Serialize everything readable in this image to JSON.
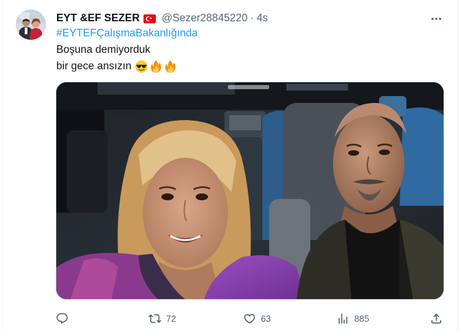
{
  "author": {
    "display_name": "EYT &EF SEZER",
    "flag_icon": "turkey-flag-icon",
    "handle": "@Sezer28845220",
    "separator": "·",
    "time": "4s"
  },
  "tweet": {
    "hashtag": "#EYTEFÇalışmaBakanlığında",
    "line1": "Boşuna demiyorduk",
    "line2": "bir gece ansızın",
    "emojis": [
      "sunglasses-emoji",
      "fire-emoji",
      "fire-emoji"
    ]
  },
  "actions": {
    "reply_count": "",
    "retweet_count": "72",
    "like_count": "63",
    "view_count": "885"
  },
  "colors": {
    "link": "#1d9bf0",
    "muted": "#536471",
    "text": "#0f1419"
  }
}
